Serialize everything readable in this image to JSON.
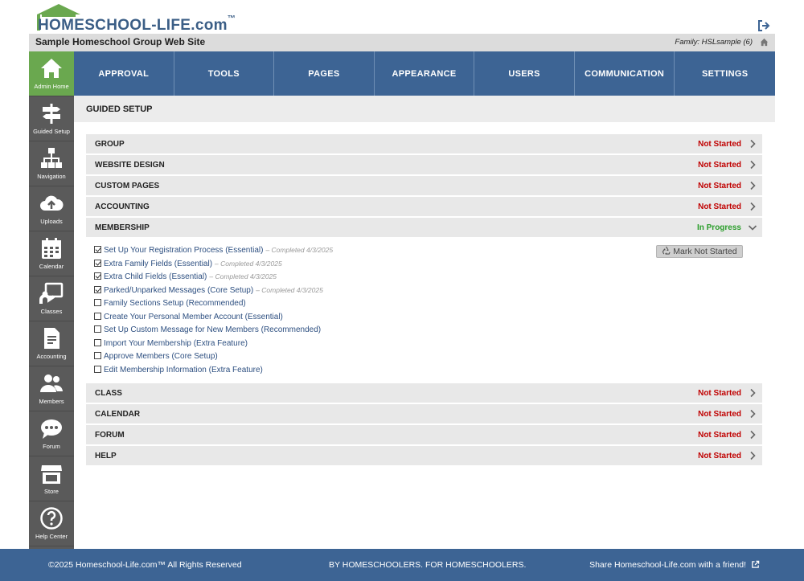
{
  "brand": {
    "logo_text": "HOMESCHOOL-LIFE.com",
    "tm": "™",
    "primary_color": "#3d6494",
    "active_color": "#6aa84f"
  },
  "site": {
    "title": "Sample Homeschool Group Web Site",
    "family": "Family: HSLsample (6)"
  },
  "sidebar": {
    "items": [
      {
        "label": "Admin Home",
        "icon": "home-icon"
      },
      {
        "label": "Guided Setup",
        "icon": "signpost-icon"
      },
      {
        "label": "Navigation",
        "icon": "sitemap-icon"
      },
      {
        "label": "Uploads",
        "icon": "cloud-upload-icon"
      },
      {
        "label": "Calendar",
        "icon": "calendar-icon"
      },
      {
        "label": "Classes",
        "icon": "chalkboard-icon"
      },
      {
        "label": "Accounting",
        "icon": "invoice-icon"
      },
      {
        "label": "Members",
        "icon": "users-icon"
      },
      {
        "label": "Forum",
        "icon": "chat-icon"
      },
      {
        "label": "Store",
        "icon": "store-icon"
      },
      {
        "label": "Help Center",
        "icon": "help-icon"
      }
    ]
  },
  "nav": {
    "items": [
      "APPROVAL",
      "TOOLS",
      "PAGES",
      "APPEARANCE",
      "USERS",
      "COMMUNICATION",
      "SETTINGS"
    ]
  },
  "guided": {
    "title": "GUIDED SETUP",
    "sections": [
      {
        "name": "GROUP",
        "status": "Not Started"
      },
      {
        "name": "WEBSITE DESIGN",
        "status": "Not Started"
      },
      {
        "name": "CUSTOM PAGES",
        "status": "Not Started"
      },
      {
        "name": "ACCOUNTING",
        "status": "Not Started"
      },
      {
        "name": "MEMBERSHIP",
        "status": "In Progress"
      },
      {
        "name": "CLASS",
        "status": "Not Started"
      },
      {
        "name": "CALENDAR",
        "status": "Not Started"
      },
      {
        "name": "FORUM",
        "status": "Not Started"
      },
      {
        "name": "HELP",
        "status": "Not Started"
      }
    ],
    "membership_tasks": [
      {
        "label": "Set Up Your Registration Process (Essential)",
        "done": true,
        "completed": "– Completed 4/3/2025"
      },
      {
        "label": "Extra Family Fields (Essential)",
        "done": true,
        "completed": "– Completed 4/3/2025"
      },
      {
        "label": "Extra Child Fields (Essential)",
        "done": true,
        "completed": "– Completed 4/3/2025"
      },
      {
        "label": "Parked/Unparked Messages (Core Setup)",
        "done": true,
        "completed": "– Completed 4/3/2025"
      },
      {
        "label": "Family Sections Setup (Recommended)",
        "done": false,
        "completed": ""
      },
      {
        "label": "Create Your Personal Member Account (Essential)",
        "done": false,
        "completed": ""
      },
      {
        "label": "Set Up Custom Message for New Members (Recommended)",
        "done": false,
        "completed": ""
      },
      {
        "label": "Import Your Membership (Extra Feature)",
        "done": false,
        "completed": ""
      },
      {
        "label": "Approve Members (Core Setup)",
        "done": false,
        "completed": ""
      },
      {
        "label": "Edit Membership Information (Extra Feature)",
        "done": false,
        "completed": ""
      }
    ],
    "mark_button": "Mark Not Started"
  },
  "footer": {
    "copyright": "©2025 Homeschool-Life.com™ All Rights Reserved",
    "tagline": "BY HOMESCHOOLERS. FOR HOMESCHOOLERS.",
    "share": "Share Homeschool-Life.com with a friend!"
  }
}
